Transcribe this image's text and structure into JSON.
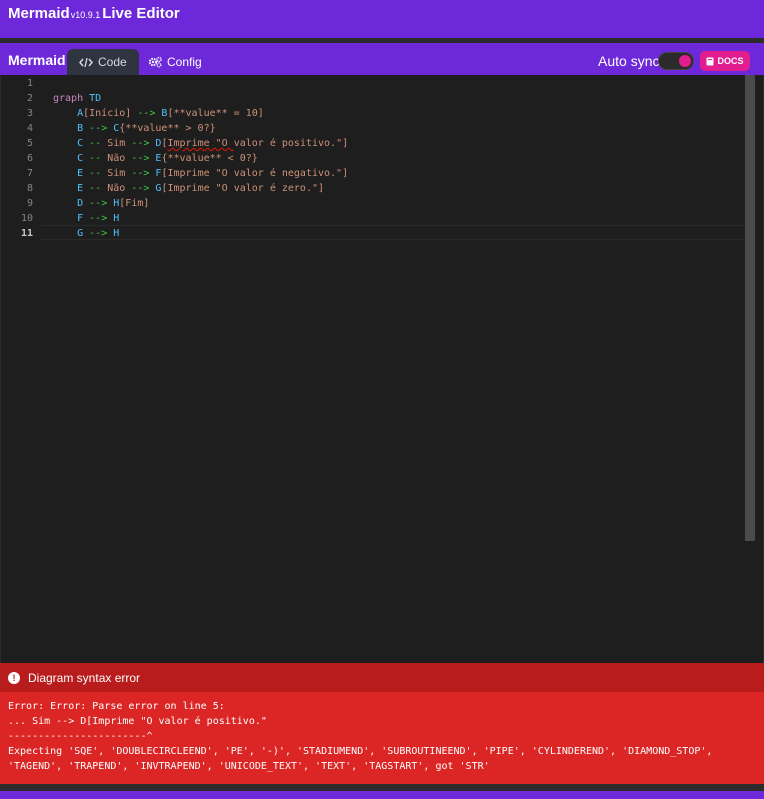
{
  "app": {
    "name": "Mermaid",
    "version": "v10.9.1",
    "title": "Live Editor"
  },
  "panel": {
    "title": "Mermaid",
    "tabs": [
      {
        "label": "Code",
        "icon": "code-icon"
      },
      {
        "label": "Config",
        "icon": "gears-icon"
      }
    ],
    "autosync_label": "Auto sync",
    "docs_label": "DOCS"
  },
  "editor": {
    "line_numbers": [
      "1",
      "2",
      "3",
      "4",
      "5",
      "6",
      "7",
      "8",
      "9",
      "10",
      "11"
    ],
    "active_line": "11",
    "lines": [
      {
        "indent": "",
        "tokens": []
      },
      {
        "indent": "",
        "tokens": [
          {
            "t": "graph",
            "c": "kw"
          },
          {
            "t": " "
          },
          {
            "t": "TD",
            "c": "id"
          }
        ]
      },
      {
        "indent": "    ",
        "tokens": [
          {
            "t": "A",
            "c": "id"
          },
          {
            "t": "[Início]",
            "c": "lbl"
          },
          {
            "t": " "
          },
          {
            "t": "-->",
            "c": "arrow"
          },
          {
            "t": " "
          },
          {
            "t": "B",
            "c": "id"
          },
          {
            "t": "[**value** = 10]",
            "c": "lbl"
          }
        ]
      },
      {
        "indent": "    ",
        "tokens": [
          {
            "t": "B",
            "c": "id"
          },
          {
            "t": " "
          },
          {
            "t": "-->",
            "c": "arrow"
          },
          {
            "t": " "
          },
          {
            "t": "C",
            "c": "id"
          },
          {
            "t": "{**value** > 0?}",
            "c": "lbl"
          }
        ]
      },
      {
        "indent": "    ",
        "tokens": [
          {
            "t": "C",
            "c": "id"
          },
          {
            "t": " "
          },
          {
            "t": "--",
            "c": "arrow"
          },
          {
            "t": " "
          },
          {
            "t": "Sim",
            "c": "txt"
          },
          {
            "t": " "
          },
          {
            "t": "-->",
            "c": "arrow"
          },
          {
            "t": " "
          },
          {
            "t": "D",
            "c": "id"
          },
          {
            "t": "[",
            "c": "lbl"
          },
          {
            "t": "Imprime \"O ",
            "c": "lbl",
            "sq": true
          },
          {
            "t": "valor é positivo.\"]",
            "c": "lbl"
          }
        ]
      },
      {
        "indent": "    ",
        "tokens": [
          {
            "t": "C",
            "c": "id"
          },
          {
            "t": " "
          },
          {
            "t": "--",
            "c": "arrow"
          },
          {
            "t": " "
          },
          {
            "t": "Não",
            "c": "txt"
          },
          {
            "t": " "
          },
          {
            "t": "-->",
            "c": "arrow"
          },
          {
            "t": " "
          },
          {
            "t": "E",
            "c": "id"
          },
          {
            "t": "{**value** < 0?}",
            "c": "lbl"
          }
        ]
      },
      {
        "indent": "    ",
        "tokens": [
          {
            "t": "E",
            "c": "id"
          },
          {
            "t": " "
          },
          {
            "t": "--",
            "c": "arrow"
          },
          {
            "t": " "
          },
          {
            "t": "Sim",
            "c": "txt"
          },
          {
            "t": " "
          },
          {
            "t": "-->",
            "c": "arrow"
          },
          {
            "t": " "
          },
          {
            "t": "F",
            "c": "id"
          },
          {
            "t": "[Imprime \"O valor é negativo.\"]",
            "c": "lbl"
          }
        ]
      },
      {
        "indent": "    ",
        "tokens": [
          {
            "t": "E",
            "c": "id"
          },
          {
            "t": " "
          },
          {
            "t": "--",
            "c": "arrow"
          },
          {
            "t": " "
          },
          {
            "t": "Não",
            "c": "txt"
          },
          {
            "t": " "
          },
          {
            "t": "-->",
            "c": "arrow"
          },
          {
            "t": " "
          },
          {
            "t": "G",
            "c": "id"
          },
          {
            "t": "[Imprime \"O valor é zero.\"]",
            "c": "lbl"
          }
        ]
      },
      {
        "indent": "    ",
        "tokens": [
          {
            "t": "D",
            "c": "id"
          },
          {
            "t": " "
          },
          {
            "t": "-->",
            "c": "arrow"
          },
          {
            "t": " "
          },
          {
            "t": "H",
            "c": "id"
          },
          {
            "t": "[Fim]",
            "c": "lbl"
          }
        ]
      },
      {
        "indent": "    ",
        "tokens": [
          {
            "t": "F",
            "c": "id"
          },
          {
            "t": " "
          },
          {
            "t": "-->",
            "c": "arrow"
          },
          {
            "t": " "
          },
          {
            "t": "H",
            "c": "id"
          }
        ]
      },
      {
        "indent": "    ",
        "tokens": [
          {
            "t": "G",
            "c": "id"
          },
          {
            "t": " "
          },
          {
            "t": "-->",
            "c": "arrow"
          },
          {
            "t": " "
          },
          {
            "t": "H",
            "c": "id"
          }
        ]
      }
    ]
  },
  "error": {
    "title": "Diagram syntax error",
    "lines": [
      "Error: Error: Parse error on line 5:",
      "... Sim --> D[Imprime \"O valor é positivo.\"",
      "-----------------------^",
      "Expecting 'SQE', 'DOUBLECIRCLEEND', 'PE', '-)', 'STADIUMEND', 'SUBROUTINEEND', 'PIPE', 'CYLINDEREND', 'DIAMOND_STOP',",
      "'TAGEND', 'TRAPEND', 'INVTRAPEND', 'UNICODE_TEXT', 'TEXT', 'TAGSTART', got 'STR'"
    ]
  },
  "colors": {
    "brand": "#6d28d9",
    "accent": "#e11d8f",
    "error_bg": "#dc2626",
    "error_header": "#b91c1c"
  }
}
